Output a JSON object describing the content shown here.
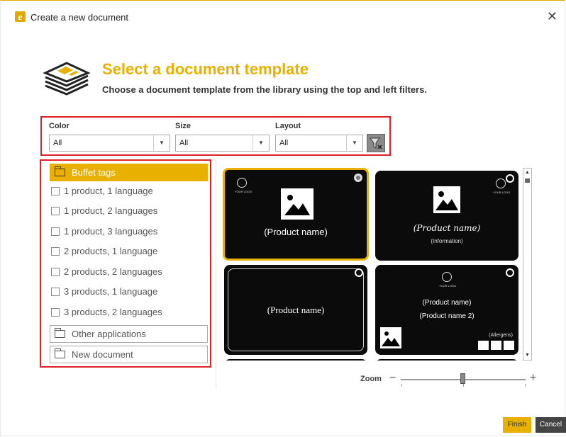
{
  "window": {
    "title": "Create a new document",
    "close_icon": "close-icon"
  },
  "header": {
    "icon": "stack-of-documents-icon",
    "title": "Select a document template",
    "subtitle": "Choose a document template from the library using the top and left filters."
  },
  "filters": {
    "color": {
      "label": "Color",
      "value": "All"
    },
    "size": {
      "label": "Size",
      "value": "All"
    },
    "layout": {
      "label": "Layout",
      "value": "All"
    },
    "clear_icon": "filter-clear-icon"
  },
  "categories": {
    "selected_folder": "Buffet tags",
    "items": [
      "1 product, 1 language",
      "1 product, 2 languages",
      "1 product, 3 languages",
      "2 products, 1 language",
      "2 products, 2 languages",
      "3 products, 1 language",
      "3 products, 2 languages"
    ],
    "other_folders": [
      "Other applications",
      "New document"
    ]
  },
  "templates": [
    {
      "name": "(Product name)",
      "logo": "YOUR LOGO",
      "selected": true
    },
    {
      "name": "(Product name)",
      "info": "(Information)",
      "logo": "YOUR LOGO",
      "selected": false
    },
    {
      "name": "(Product name)",
      "selected": false
    },
    {
      "name": "(Product name)",
      "name2": "(Product name 2)",
      "logo": "YOUR LOGO",
      "allergens": "(Allergens)",
      "selected": false
    }
  ],
  "zoom": {
    "label": "Zoom",
    "minus": "−",
    "plus": "+",
    "level": 0.5
  },
  "buttons": {
    "finish": "Finish",
    "cancel": "Cancel"
  },
  "colors": {
    "accent": "#e8b000",
    "highlight_border": "#e0202a",
    "card_bg": "#0b0b0b"
  }
}
